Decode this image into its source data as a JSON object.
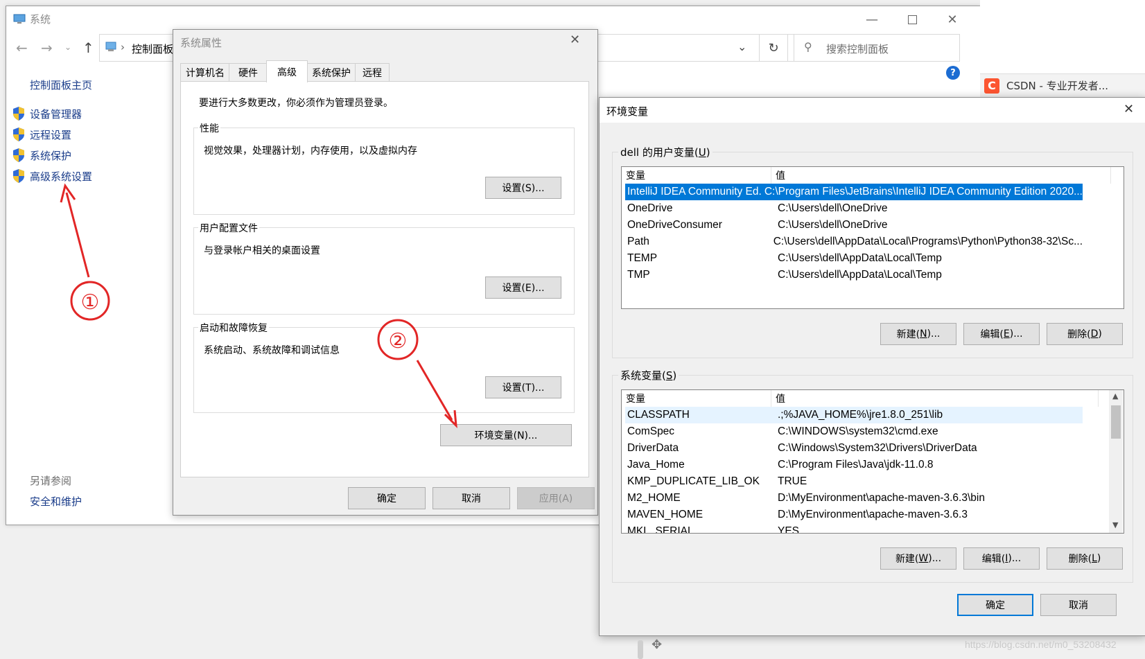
{
  "system_window": {
    "title": "系统",
    "breadcrumb_root": "控制面板",
    "search_placeholder": "搜索控制面板",
    "help_symbol": "?",
    "sidebar": {
      "home": "控制面板主页",
      "links": [
        "设备管理器",
        "远程设置",
        "系统保护",
        "高级系统设置"
      ],
      "see_also_label": "另请参阅",
      "see_also_link": "安全和维护"
    },
    "browser_tab": {
      "icon_letter": "C",
      "title": "CSDN - 专业开发者..."
    }
  },
  "system_properties": {
    "title": "系统属性",
    "tabs": [
      "计算机名",
      "硬件",
      "高级",
      "系统保护",
      "远程"
    ],
    "active_tab": "高级",
    "admin_note": "要进行大多数更改，你必须作为管理员登录。",
    "groups": [
      {
        "label": "性能",
        "desc": "视觉效果，处理器计划，内存使用，以及虚拟内存",
        "button": "设置(S)..."
      },
      {
        "label": "用户配置文件",
        "desc": "与登录帐户相关的桌面设置",
        "button": "设置(E)..."
      },
      {
        "label": "启动和故障恢复",
        "desc": "系统启动、系统故障和调试信息",
        "button": "设置(T)..."
      }
    ],
    "env_button": "环境变量(N)...",
    "ok": "确定",
    "cancel": "取消",
    "apply": "应用(A)"
  },
  "env_vars": {
    "title": "环境变量",
    "user_section": {
      "label_prefix": "dell 的用户变量(",
      "label_key": "U",
      "label_suffix": ")",
      "col_var": "变量",
      "col_val": "值",
      "rows": [
        {
          "name": "IntelliJ IDEA Community Ed...",
          "value": "C:\\Program Files\\JetBrains\\IntelliJ IDEA Community Edition 2020...",
          "selected": true
        },
        {
          "name": "OneDrive",
          "value": "C:\\Users\\dell\\OneDrive"
        },
        {
          "name": "OneDriveConsumer",
          "value": "C:\\Users\\dell\\OneDrive"
        },
        {
          "name": "Path",
          "value": "C:\\Users\\dell\\AppData\\Local\\Programs\\Python\\Python38-32\\Sc..."
        },
        {
          "name": "TEMP",
          "value": "C:\\Users\\dell\\AppData\\Local\\Temp"
        },
        {
          "name": "TMP",
          "value": "C:\\Users\\dell\\AppData\\Local\\Temp"
        }
      ],
      "buttons": {
        "new_pre": "新建(",
        "new_key": "N",
        "edit_pre": "编辑(",
        "edit_key": "E",
        "del_pre": "删除(",
        "del_key": "D",
        "ell": ")...",
        "close": ")"
      }
    },
    "system_section": {
      "label_prefix": "系统变量(",
      "label_key": "S",
      "label_suffix": ")",
      "col_var": "变量",
      "col_val": "值",
      "rows": [
        {
          "name": "CLASSPATH",
          "value": ".;%JAVA_HOME%\\jre1.8.0_251\\lib",
          "hover": true
        },
        {
          "name": "ComSpec",
          "value": "C:\\WINDOWS\\system32\\cmd.exe"
        },
        {
          "name": "DriverData",
          "value": "C:\\Windows\\System32\\Drivers\\DriverData"
        },
        {
          "name": "Java_Home",
          "value": "C:\\Program Files\\Java\\jdk-11.0.8"
        },
        {
          "name": "KMP_DUPLICATE_LIB_OK",
          "value": "TRUE"
        },
        {
          "name": "M2_HOME",
          "value": "D:\\MyEnvironment\\apache-maven-3.6.3\\bin"
        },
        {
          "name": "MAVEN_HOME",
          "value": "D:\\MyEnvironment\\apache-maven-3.6.3"
        },
        {
          "name": "MKL_SERIAL",
          "value": "YES"
        }
      ],
      "buttons": {
        "new_pre": "新建(",
        "new_key": "W",
        "edit_pre": "编辑(",
        "edit_key": "I",
        "del_pre": "删除(",
        "del_key": "L",
        "ell": ")...",
        "close": ")"
      }
    },
    "ok": "确定",
    "cancel": "取消"
  },
  "annotations": {
    "step1": "①",
    "step2": "②"
  },
  "watermark": "https://blog.csdn.net/m0_53208432"
}
